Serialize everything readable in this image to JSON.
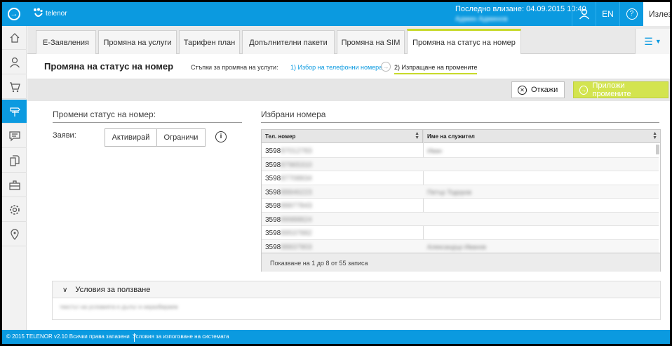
{
  "topbar": {
    "brand": "telenor",
    "last_login_label": "Последно влизане: 04.09.2015 10:40",
    "user_name": "Админ Админов",
    "lang": "EN",
    "help": "?",
    "logout": "Излез"
  },
  "sidebar": {
    "items": [
      {
        "name": "home-icon"
      },
      {
        "name": "user-icon"
      },
      {
        "name": "cart-icon"
      },
      {
        "name": "services-icon",
        "active": true
      },
      {
        "name": "messages-icon"
      },
      {
        "name": "documents-icon"
      },
      {
        "name": "briefcase-icon"
      },
      {
        "name": "settings-icon"
      },
      {
        "name": "location-icon"
      }
    ]
  },
  "tabs": [
    {
      "label": "E-Заявления"
    },
    {
      "label": "Промяна на услуги"
    },
    {
      "label": "Тарифен план"
    },
    {
      "label": "Допълнителни пакети"
    },
    {
      "label": "Промяна на SIM"
    },
    {
      "label": "Промяна на статус на номер",
      "active": true
    }
  ],
  "header": {
    "title": "Промяна на статус на номер",
    "steps_label": "Стъпки за промяна на услуги:",
    "step1": "1) Избор на телефонни номера",
    "step2": "2) Изпращане на промените"
  },
  "actions": {
    "cancel": "Откажи",
    "apply": "Приложи промените"
  },
  "left": {
    "title": "Промени статус на номер:",
    "claim_label": "Заяви:",
    "activate": "Активирай",
    "limit": "Ограничи",
    "info": "i"
  },
  "right": {
    "title": "Избрани номера",
    "columns": [
      "Тел. номер",
      "Име на служител"
    ],
    "rows": [
      {
        "prefix": "3598",
        "hidden": "87012783",
        "name": "Иван"
      },
      {
        "prefix": "3598",
        "hidden": "87965310",
        "name": ""
      },
      {
        "prefix": "3598",
        "hidden": "87708834",
        "name": ""
      },
      {
        "prefix": "3598",
        "hidden": "88846223",
        "name": "Петър Тодоров"
      },
      {
        "prefix": "3598",
        "hidden": "88877843",
        "name": ""
      },
      {
        "prefix": "3598",
        "hidden": "99988824",
        "name": ""
      },
      {
        "prefix": "3598",
        "hidden": "89537882",
        "name": ""
      },
      {
        "prefix": "3598",
        "hidden": "98837903",
        "name": "Александър Иванов"
      }
    ],
    "footer": "Показване на 1 до 8 от 55 записа"
  },
  "terms": {
    "title": "Условия за ползване",
    "body": "текстът на условията е дълъг и неразбираем"
  },
  "footer": {
    "copyright": "© 2015 TELENOR v2.10 Всички права запазени",
    "terms_link": "Условия за използване на системата"
  }
}
